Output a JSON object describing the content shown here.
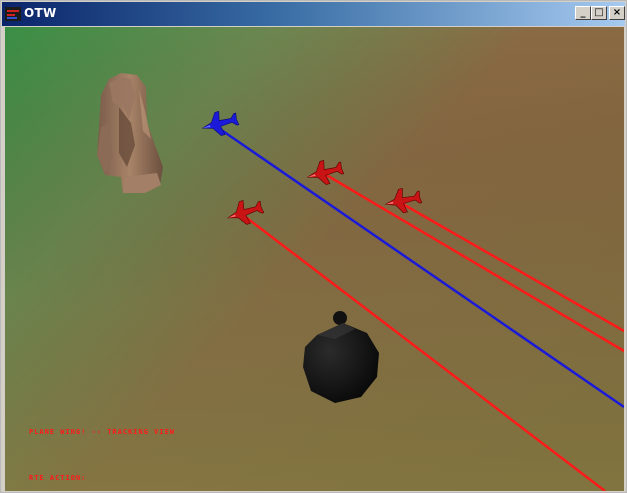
{
  "window": {
    "title": "OTW",
    "minimize_glyph": "_",
    "maximize_glyph": "□",
    "close_glyph": "×"
  },
  "scene": {
    "ground_colors": [
      "#3f9048",
      "#5f8a52",
      "#8a6a45",
      "#7f6748"
    ],
    "friendly_color": "#1a1ad8",
    "enemy_color": "#ff1a1a",
    "aircraft": [
      {
        "id": "blue-plane",
        "side": "friendly",
        "color": "#1a1ad8"
      },
      {
        "id": "red-plane-1",
        "side": "enemy",
        "color": "#c81414"
      },
      {
        "id": "red-plane-2",
        "side": "enemy",
        "color": "#c81414"
      },
      {
        "id": "red-plane-3",
        "side": "enemy",
        "color": "#c81414"
      }
    ],
    "objects": [
      "rock-formation",
      "dark-boulder"
    ]
  },
  "hud": {
    "mode_text": "PLANE WING! -- TRACKING VIEW",
    "action_text": "RTE ACTION:"
  }
}
